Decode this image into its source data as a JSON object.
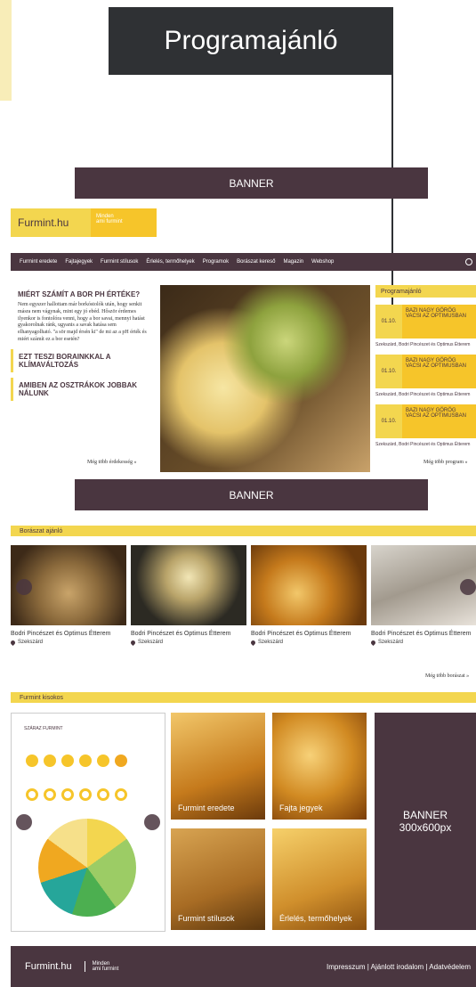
{
  "callout": {
    "label": "Programajánló"
  },
  "banners": {
    "top": "BANNER",
    "middle": "BANNER",
    "side_line1": "BANNER",
    "side_line2": "300x600px"
  },
  "logo": {
    "name": "Furmint.hu",
    "tagline_line1": "Minden",
    "tagline_line2": "ami furmint"
  },
  "nav": {
    "items": [
      "Furmint eredete",
      "Fajtajegyek",
      "Furmint stílusok",
      "Érlelés, termőhelyek",
      "Programok",
      "Borászat kereső",
      "Magazin",
      "Webshop"
    ],
    "search_icon": "search-icon"
  },
  "articles": {
    "main_title": "MIÉRT SZÁMÍT A BOR PH ÉRTÉKE?",
    "main_body": "Nem egyszer hallottam már borkóstolók után, hogy senkit másra nem vágynak, mint egy jó ebéd. Hőször érdemes ilyenkor is fontolóra venni, hogy a bor savai, mennyi hatást gyakorolnak ránk, ugyanis a savak hatása sem elhanyagolható. \"a sör majd érsén ki\" de mi az a pH érték és miért számít ez a bor esetén?",
    "item2": "EZT TESZI BORAINKKAL A KLÍMAVÁLTOZÁS",
    "item3": "AMIBEN AZ OSZTRÁKOK JOBBAK NÁLUNK",
    "more": "Még több érdekesség »"
  },
  "programs": {
    "heading": "Programajánló",
    "items": [
      {
        "date": "01.10.",
        "title": "BAZI NAGY GÖRÖG VACSI AZ OPTIMUSBAN",
        "place": "Szekszárd, Bodri Pincészet és Optimus Étterem"
      },
      {
        "date": "01.10.",
        "title": "BAZI NAGY GÖRÖG VACSI AZ OPTIMUSBAN",
        "place": "Szekszárd, Bodri Pincészet és Optimus Étterem"
      },
      {
        "date": "01.10.",
        "title": "BAZI NAGY GÖRÖG VACSI AZ OPTIMUSBAN",
        "place": "Szekszárd, Bodri Pincészet és Optimus Étterem"
      }
    ],
    "more": "Még több program »"
  },
  "winery": {
    "heading": "Borászat ajánló",
    "cards": [
      {
        "title": "Bodri Pincészet és Optimus Étterem",
        "location": "Szekszárd"
      },
      {
        "title": "Bodri Pincészet és Optimus Étterem",
        "location": "Szekszárd"
      },
      {
        "title": "Bodri Pincészet és Optimus Étterem",
        "location": "Szekszárd"
      },
      {
        "title": "Bodri Pincészet és Optimus Étterem",
        "location": "Szekszárd"
      }
    ],
    "more": "Még több borászat »"
  },
  "kiosk": {
    "heading": "Furmint kisokos",
    "panel_title": "SZÁRAZ FURMINT",
    "tiles": [
      "Furmint eredete",
      "Fajta jegyek",
      "Furmint stílusok",
      "Érlelés, termőhelyek"
    ]
  },
  "footer": {
    "logo": "Furmint.hu",
    "tagline_line1": "Minden",
    "tagline_line2": "ami furmint",
    "links": "Impresszum | Ajánlott irodalom | Adatvédelem"
  }
}
